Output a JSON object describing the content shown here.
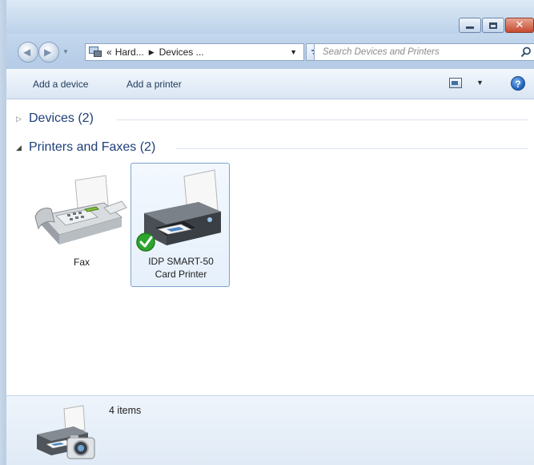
{
  "window": {
    "caption_buttons": {
      "minimize_icon": "minimize-icon",
      "maximize_icon": "maximize-icon",
      "close_glyph": "✕"
    }
  },
  "address_bar": {
    "overflow": "«",
    "crumbs": [
      "Hard...",
      "Devices ..."
    ],
    "search_placeholder": "Search Devices and Printers"
  },
  "toolbar": {
    "add_device": "Add a device",
    "add_printer": "Add a printer",
    "help": "?"
  },
  "groups": {
    "devices": {
      "title": "Devices (2)",
      "expanded": false
    },
    "printers": {
      "title": "Printers and Faxes (2)",
      "expanded": true
    }
  },
  "items": {
    "fax": {
      "label": "Fax"
    },
    "printer": {
      "label_line1": "IDP SMART-50",
      "label_line2": "Card Printer",
      "is_default": true
    }
  },
  "details": {
    "count": "4 items"
  },
  "colors": {
    "accent": "#1e3f7a",
    "selection_border": "#7da2ce",
    "default_check": "#2ea52e"
  }
}
